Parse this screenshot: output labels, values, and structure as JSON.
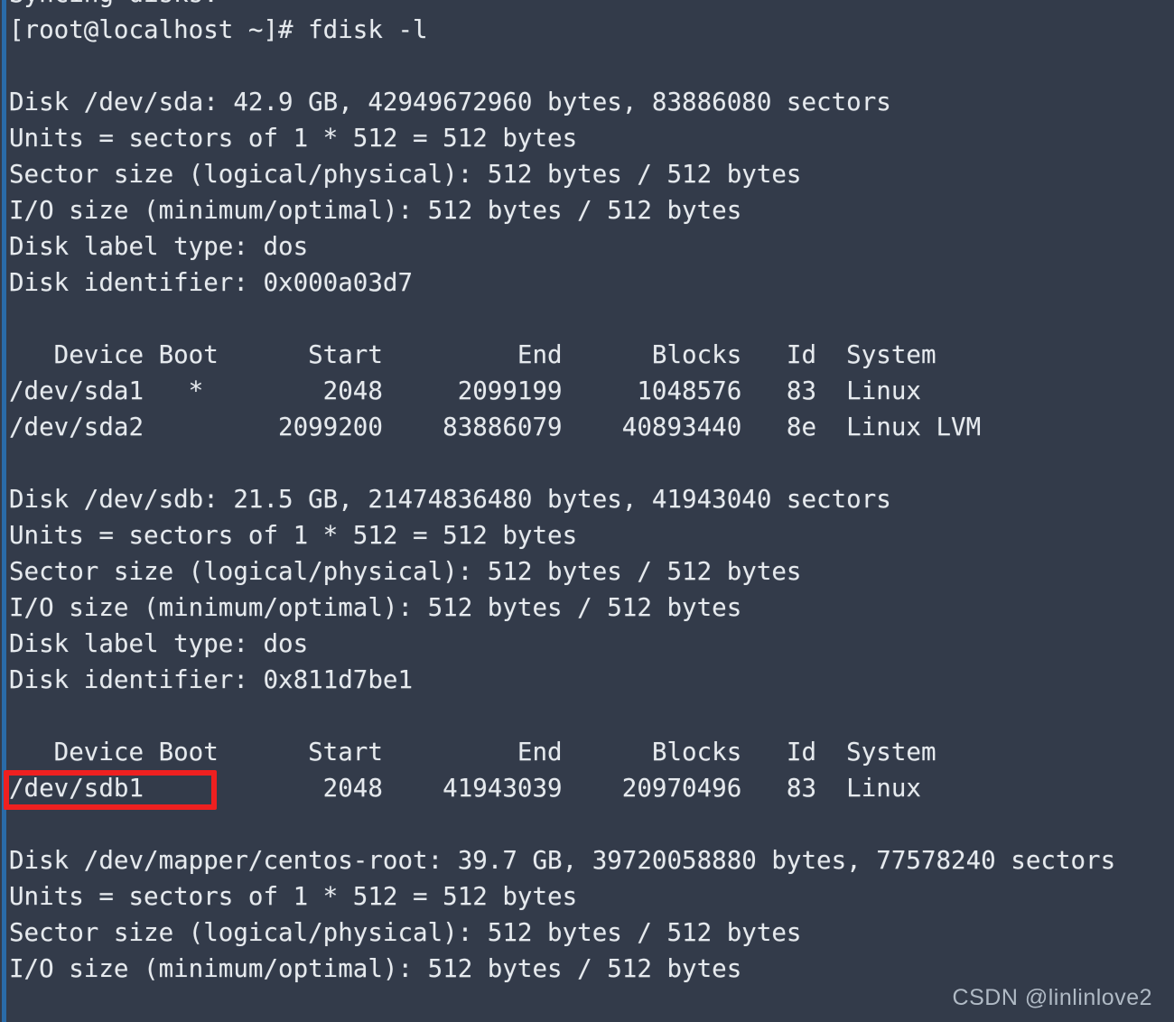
{
  "terminal": {
    "background_color": "#333b4a",
    "foreground_color": "#e6eaee",
    "accent_stripe_color": "#2a6ba8",
    "highlight_color": "#ee2020",
    "prompt": "[root@localhost ~]# ",
    "command": "fdisk -l",
    "lines": [
      "Syncing disks.",
      "[root@localhost ~]# fdisk -l",
      "",
      "Disk /dev/sda: 42.9 GB, 42949672960 bytes, 83886080 sectors",
      "Units = sectors of 1 * 512 = 512 bytes",
      "Sector size (logical/physical): 512 bytes / 512 bytes",
      "I/O size (minimum/optimal): 512 bytes / 512 bytes",
      "Disk label type: dos",
      "Disk identifier: 0x000a03d7",
      "",
      "   Device Boot      Start         End      Blocks   Id  System",
      "/dev/sda1   *        2048     2099199     1048576   83  Linux",
      "/dev/sda2         2099200    83886079    40893440   8e  Linux LVM",
      "",
      "Disk /dev/sdb: 21.5 GB, 21474836480 bytes, 41943040 sectors",
      "Units = sectors of 1 * 512 = 512 bytes",
      "Sector size (logical/physical): 512 bytes / 512 bytes",
      "I/O size (minimum/optimal): 512 bytes / 512 bytes",
      "Disk label type: dos",
      "Disk identifier: 0x811d7be1",
      "",
      "   Device Boot      Start         End      Blocks   Id  System",
      "/dev/sdb1            2048    41943039    20970496   83  Linux",
      "",
      "Disk /dev/mapper/centos-root: 39.7 GB, 39720058880 bytes, 77578240 sectors",
      "Units = sectors of 1 * 512 = 512 bytes",
      "Sector size (logical/physical): 512 bytes / 512 bytes",
      "I/O size (minimum/optimal): 512 bytes / 512 bytes"
    ]
  },
  "disks": [
    {
      "device": "/dev/sda",
      "size_human": "42.9 GB",
      "size_bytes": "42949672960",
      "sectors": "83886080",
      "units": "sectors of 1 * 512 = 512 bytes",
      "sector_size_logical": "512 bytes",
      "sector_size_physical": "512 bytes",
      "io_size_minimum": "512 bytes",
      "io_size_optimal": "512 bytes",
      "label_type": "dos",
      "identifier": "0x000a03d7",
      "table_headers": [
        "Device",
        "Boot",
        "Start",
        "End",
        "Blocks",
        "Id",
        "System"
      ],
      "partitions": [
        {
          "device": "/dev/sda1",
          "boot": "*",
          "start": "2048",
          "end": "2099199",
          "blocks": "1048576",
          "id": "83",
          "system": "Linux"
        },
        {
          "device": "/dev/sda2",
          "boot": "",
          "start": "2099200",
          "end": "83886079",
          "blocks": "40893440",
          "id": "8e",
          "system": "Linux LVM"
        }
      ]
    },
    {
      "device": "/dev/sdb",
      "size_human": "21.5 GB",
      "size_bytes": "21474836480",
      "sectors": "41943040",
      "units": "sectors of 1 * 512 = 512 bytes",
      "sector_size_logical": "512 bytes",
      "sector_size_physical": "512 bytes",
      "io_size_minimum": "512 bytes",
      "io_size_optimal": "512 bytes",
      "label_type": "dos",
      "identifier": "0x811d7be1",
      "table_headers": [
        "Device",
        "Boot",
        "Start",
        "End",
        "Blocks",
        "Id",
        "System"
      ],
      "partitions": [
        {
          "device": "/dev/sdb1",
          "boot": "",
          "start": "2048",
          "end": "41943039",
          "blocks": "20970496",
          "id": "83",
          "system": "Linux",
          "highlighted": true
        }
      ]
    },
    {
      "device": "/dev/mapper/centos-root",
      "size_human": "39.7 GB",
      "size_bytes": "39720058880",
      "sectors": "77578240",
      "units": "sectors of 1 * 512 = 512 bytes",
      "sector_size_logical": "512 bytes",
      "sector_size_physical": "512 bytes",
      "io_size_minimum": "512 bytes",
      "io_size_optimal": "512 bytes"
    }
  ],
  "annotation": {
    "highlight_target": "/dev/sdb1",
    "highlight_color": "#ee2020"
  },
  "watermark": {
    "text": "CSDN @linlinlove2"
  }
}
